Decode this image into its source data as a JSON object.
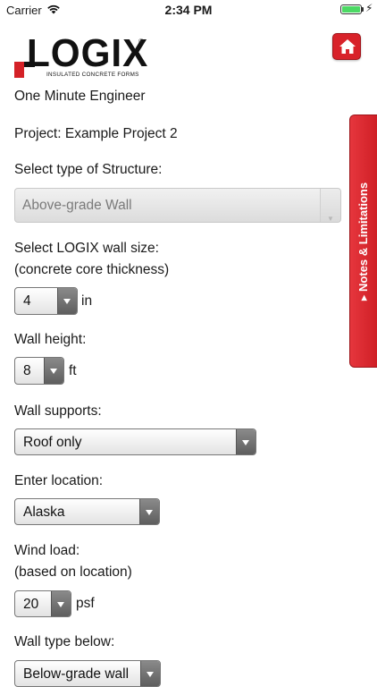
{
  "status": {
    "carrier": "Carrier",
    "time": "2:34 PM",
    "battery_level": 1.0
  },
  "logo": {
    "text": "LOGIX",
    "subtitle": "INSULATED CONCRETE FORMS",
    "registered": "®"
  },
  "home_button": {
    "icon": "home-icon"
  },
  "app_title": "One Minute Engineer",
  "project_label": "Project: Example Project 2",
  "structure": {
    "label": "Select type of Structure:",
    "value": "Above-grade Wall"
  },
  "wall_size": {
    "label_line1": "Select LOGIX wall size:",
    "label_line2": "(concrete core thickness)",
    "value": "4",
    "unit": "in"
  },
  "wall_height": {
    "label": "Wall height:",
    "value": "8",
    "unit": "ft"
  },
  "wall_supports": {
    "label": "Wall supports:",
    "value": "Roof only"
  },
  "location": {
    "label": "Enter location:",
    "value": "Alaska"
  },
  "wind_load": {
    "label_line1": "Wind load:",
    "label_line2": "(based on location)",
    "value": "20",
    "unit": "psf"
  },
  "wall_type_below": {
    "label": "Wall type below:",
    "value": "Below-grade wall"
  },
  "side_tab": {
    "label": "▸ Notes & Limitations"
  },
  "colors": {
    "accent_red": "#d8222a",
    "battery_green": "#4cd964"
  }
}
